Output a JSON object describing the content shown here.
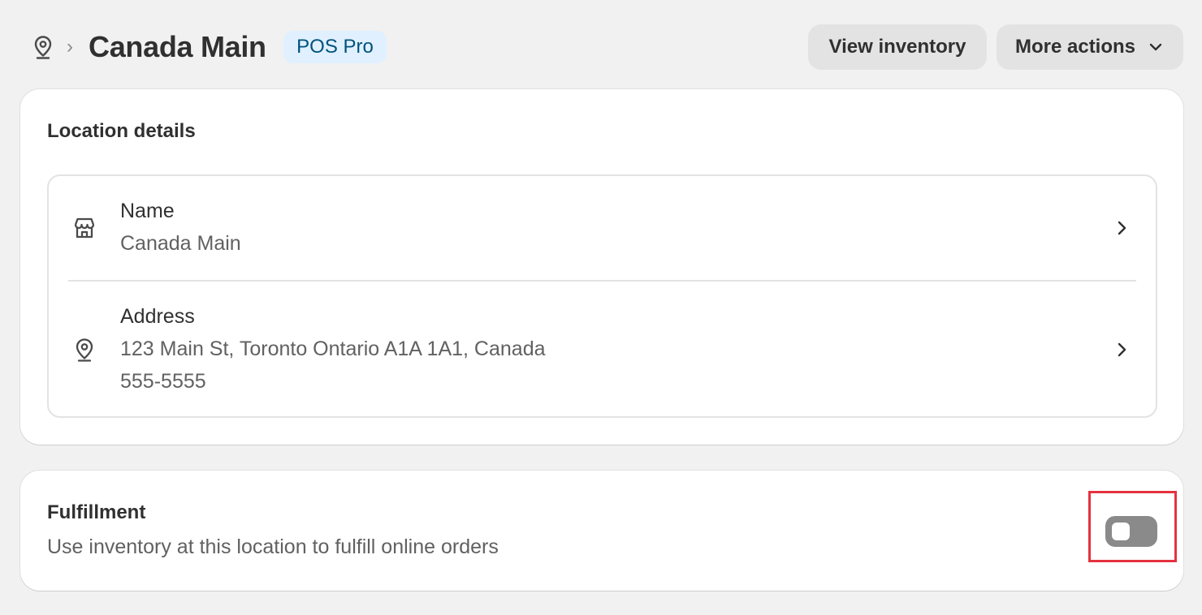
{
  "header": {
    "location_icon": "location-pin-icon",
    "separator": "›",
    "title": "Canada Main",
    "badge": "POS Pro",
    "view_inventory_label": "View inventory",
    "more_actions_label": "More actions"
  },
  "location_details": {
    "title": "Location details",
    "rows": [
      {
        "icon": "store-icon",
        "label": "Name",
        "values": [
          "Canada Main"
        ]
      },
      {
        "icon": "location-pin-icon",
        "label": "Address",
        "values": [
          "123 Main St, Toronto Ontario A1A 1A1, Canada",
          "555-5555"
        ]
      }
    ]
  },
  "fulfillment": {
    "title": "Fulfillment",
    "description": "Use inventory at this location to fulfill online orders",
    "enabled": false
  },
  "colors": {
    "background": "#f1f1f1",
    "badge_bg": "#e0f0ff",
    "badge_text": "#00527c",
    "toggle_off": "#8a8a8a",
    "highlight": "#e5323e"
  }
}
